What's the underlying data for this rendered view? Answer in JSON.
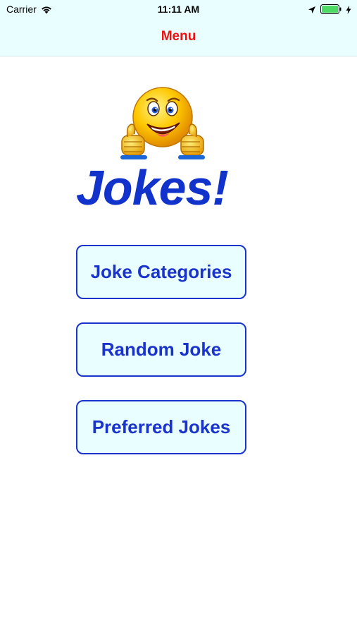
{
  "status_bar": {
    "carrier": "Carrier",
    "time": "11:11 AM",
    "icons": [
      "wifi-icon",
      "location-arrow-icon",
      "battery-icon",
      "charging-bolt-icon"
    ]
  },
  "nav": {
    "title": "Menu",
    "title_color": "#ee1111",
    "background": "#e8feff"
  },
  "header": {
    "logo_icon": "thumbs-up-smiley-icon",
    "title": "Jokes!",
    "title_color": "#1133cc"
  },
  "menu": {
    "button_color": "#1a33cc",
    "items": [
      {
        "label": "Joke Categories"
      },
      {
        "label": "Random Joke"
      },
      {
        "label": "Preferred Jokes"
      }
    ]
  }
}
